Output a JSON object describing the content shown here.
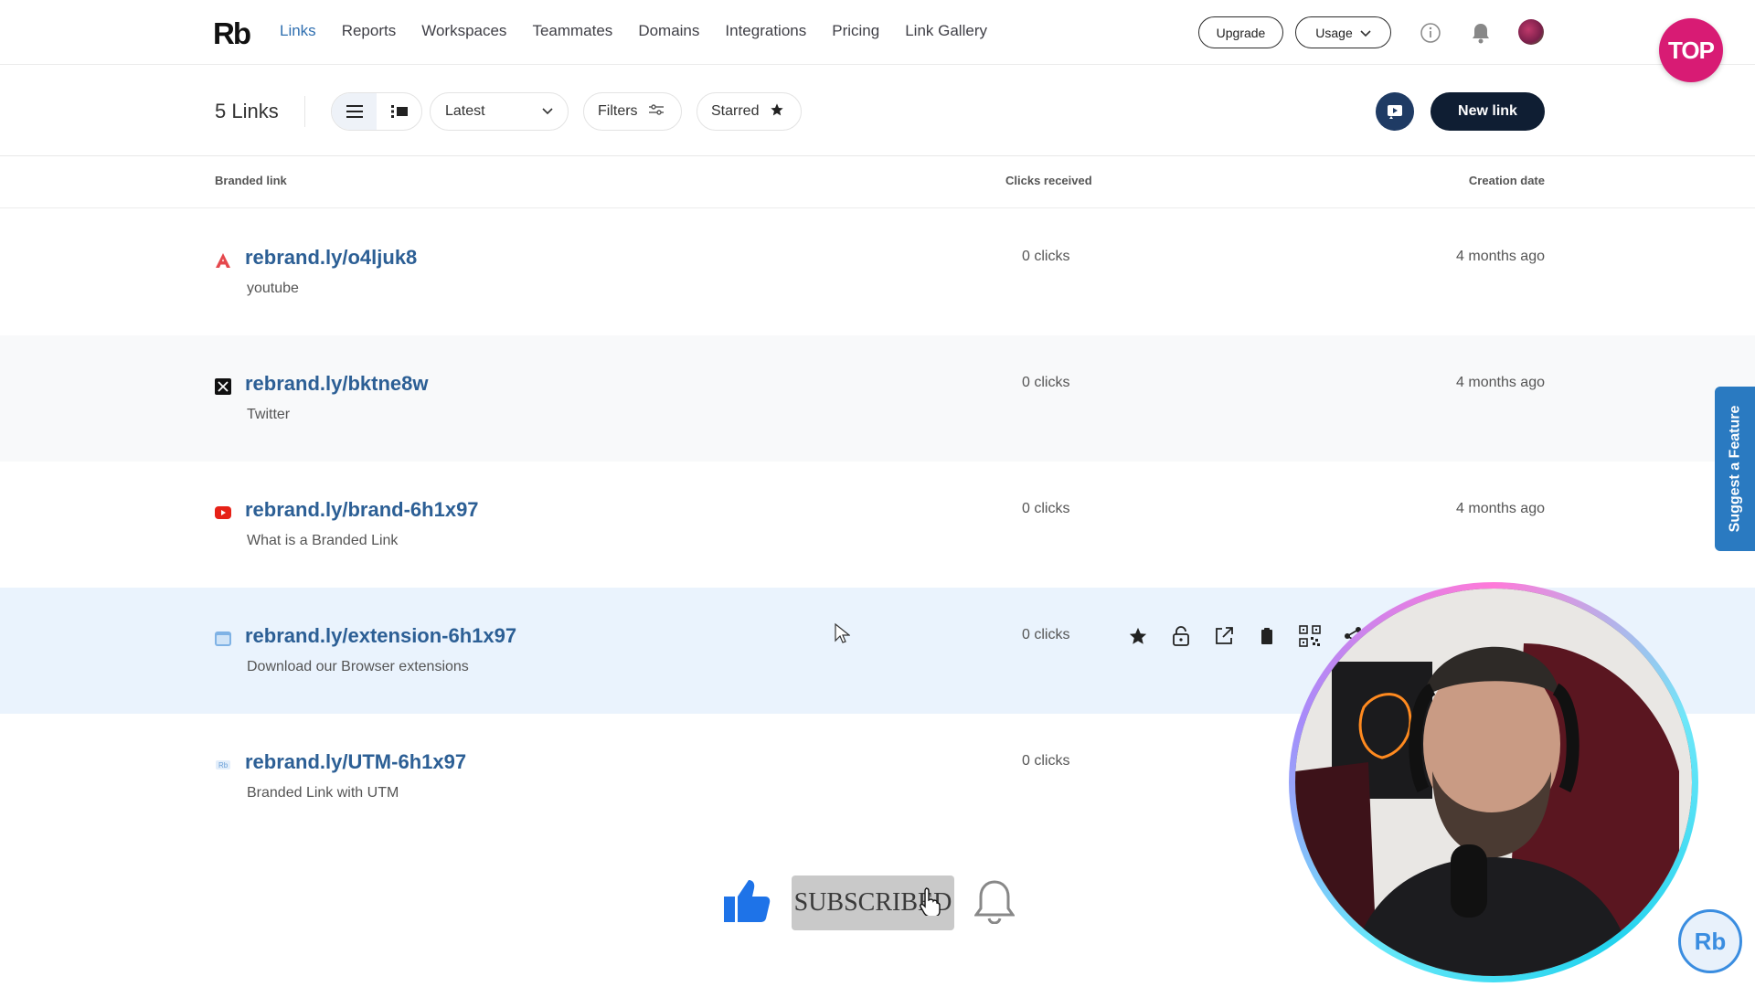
{
  "brand": {
    "logo_text": "Rb",
    "accent": "#2f6fb0"
  },
  "nav": {
    "links": [
      "Links",
      "Reports",
      "Workspaces",
      "Teammates",
      "Domains",
      "Integrations",
      "Pricing",
      "Link Gallery"
    ],
    "active": "Links",
    "upgrade_label": "Upgrade",
    "usage_label": "Usage"
  },
  "badge_text": "TOP",
  "toolbar": {
    "count_label": "5 Links",
    "sort_value": "Latest",
    "filters_label": "Filters",
    "starred_label": "Starred",
    "new_link_label": "New link"
  },
  "table": {
    "headers": {
      "link": "Branded link",
      "clicks": "Clicks received",
      "date": "Creation date"
    },
    "rows": [
      {
        "icon": "adobe-icon",
        "link": "rebrand.ly/o4ljuk8",
        "title": "youtube",
        "clicks": "0 clicks",
        "date": "4 months ago"
      },
      {
        "icon": "x-twitter-icon",
        "link": "rebrand.ly/bktne8w",
        "title": "Twitter",
        "clicks": "0 clicks",
        "date": "4 months ago"
      },
      {
        "icon": "youtube-icon",
        "link": "rebrand.ly/brand-6h1x97",
        "title": "What is a Branded Link",
        "clicks": "0 clicks",
        "date": "4 months ago"
      },
      {
        "icon": "rebrandly-icon",
        "link": "rebrand.ly/extension-6h1x97",
        "title": "Download our Browser extensions",
        "clicks": "0 clicks",
        "date": ""
      },
      {
        "icon": "rebrandly-small-icon",
        "link": "rebrand.ly/UTM-6h1x97",
        "title": "Branded Link with UTM",
        "clicks": "0 clicks",
        "date": ""
      }
    ]
  },
  "suggest_label": "Suggest a Feature",
  "overlay": {
    "subscribe_label": "SUBSCRIBED"
  },
  "chat_label": "Rb"
}
